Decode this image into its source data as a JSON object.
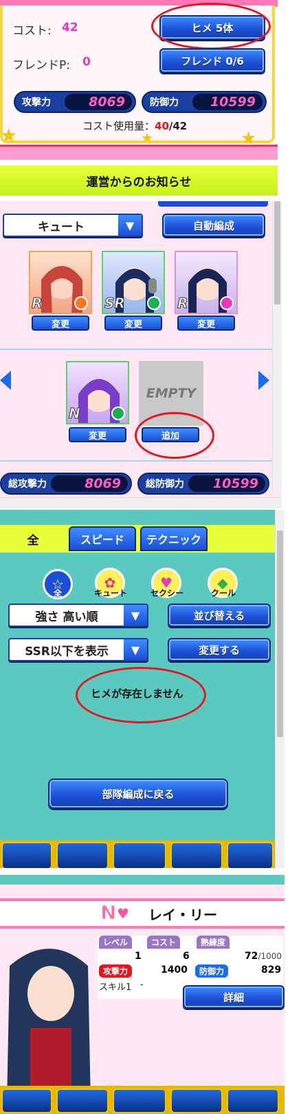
{
  "top_panel": {
    "cost_label": "コスト:",
    "cost_value": "42",
    "friend_label": "フレンドP:",
    "friend_value": "0",
    "hime_button": "ヒメ 5体",
    "friend_button": "フレンド 0/6",
    "attack_label": "攻撃力",
    "attack_value": "8069",
    "defense_label": "防御力",
    "defense_value": "10599",
    "cost_usage_label": "コスト使用量：",
    "cost_usage_current": "40",
    "cost_usage_max": "/42",
    "notice_banner": "運営からのお知らせ"
  },
  "formation": {
    "type_select": "キュート",
    "auto_button": "自動編成",
    "top_row": [
      {
        "rarity": "R",
        "change_label": "変更",
        "attr_color": "#ff7a1a"
      },
      {
        "rarity": "SR",
        "change_label": "変更",
        "attr_color": "#1fae4b"
      },
      {
        "rarity": "R",
        "change_label": "変更",
        "attr_color": "#e23ab8"
      }
    ],
    "bottom_row": [
      {
        "rarity": "N",
        "change_label": "変更",
        "attr_color": "#1fae4b"
      }
    ],
    "empty_slot_text": "EMPTY",
    "add_button": "追加",
    "total_attack_label": "総攻撃力",
    "total_attack_value": "8069",
    "total_defense_label": "総防御力",
    "total_defense_value": "10599"
  },
  "list_screen": {
    "tabs": [
      "全",
      "スピード",
      "テクニック"
    ],
    "filters": [
      {
        "label": "全",
        "color": "#1b4fd6"
      },
      {
        "label": "キュート",
        "color": "#e8376f"
      },
      {
        "label": "セクシー",
        "color": "#e23ab8"
      },
      {
        "label": "クール",
        "color": "#2bb34a"
      }
    ],
    "sort_select": "強さ 高い順",
    "sort_button": "並び替える",
    "rarity_select": "SSR以下を表示",
    "apply_button": "変更する",
    "empty_message": "ヒメが存在しません",
    "back_button": "部隊編成に戻る"
  },
  "detail": {
    "rarity": "N",
    "name": "レイ・リー",
    "level_label": "レベル",
    "level_value": "1",
    "cost_label": "コスト",
    "cost_value": "6",
    "mastery_label": "熟練度",
    "mastery_value": "72",
    "mastery_max": "/1000",
    "attack_label": "攻撃力",
    "attack_value": "1400",
    "defense_label": "防御力",
    "defense_value": "829",
    "skill_label": "スキル1",
    "skill_value": "-",
    "detail_button": "詳細"
  },
  "colors": {
    "accent_blue": "#1b4fd6",
    "pink_value": "#ff5fc4",
    "red_highlight": "#e8151f",
    "gold_border": "#f5c400",
    "teal_bg": "#5cc9c0"
  }
}
